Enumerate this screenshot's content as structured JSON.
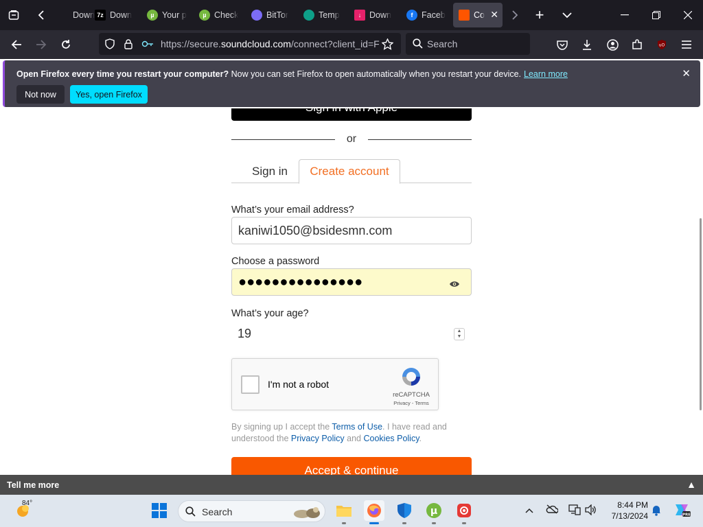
{
  "browser": {
    "tabs": [
      {
        "label": "Down",
        "favicon": "download-icon",
        "color": "#2b2a33"
      },
      {
        "label": "Down",
        "favicon": "7zip-icon",
        "color": "#000000"
      },
      {
        "label": "Your p",
        "favicon": "utorrent-icon",
        "color": "#76b83f"
      },
      {
        "label": "Check",
        "favicon": "utorrent-icon",
        "color": "#76b83f"
      },
      {
        "label": "BitTor",
        "favicon": "gauge-icon",
        "color": "#7b6cf6"
      },
      {
        "label": "Temp",
        "favicon": "temp-mail-icon",
        "color": "#0e9f88"
      },
      {
        "label": "Down",
        "favicon": "download-icon",
        "color": "#e6216a"
      },
      {
        "label": "Faceb",
        "favicon": "facebook-icon",
        "color": "#1877f2"
      },
      {
        "label": "Co",
        "favicon": "soundcloud-icon",
        "color": "#ff5500"
      }
    ],
    "url_prefix": "https://secure.",
    "url_domain": "soundcloud.com",
    "url_rest": "/connect?client_id=F",
    "search_placeholder": "Search"
  },
  "notification": {
    "bold_text": "Open Firefox every time you restart your computer?",
    "text": " Now you can set Firefox to open automatically when you restart your device.",
    "link": "Learn more",
    "not_now": "Not now",
    "yes_open": "Yes, open Firefox"
  },
  "page": {
    "apple_button": "Sign in with Apple",
    "or_text": "or",
    "tab_signin": "Sign in",
    "tab_create": "Create account",
    "email_label": "What’s your email address?",
    "email_value": "kaniwi1050@bsidesmn.com",
    "password_label": "Choose a password",
    "password_dots": "●●●●●●●●●●●●●●●",
    "age_label": "What’s your age?",
    "age_value": "19",
    "captcha_label": "I'm not a robot",
    "captcha_brand": "reCAPTCHA",
    "captcha_links": "Privacy - Terms",
    "terms_1": "By signing up I accept the ",
    "terms_link1": "Terms of Use",
    "terms_2": ". I have read and understood the ",
    "terms_link2": "Privacy Policy",
    "terms_3": " and ",
    "terms_link3": "Cookies Policy",
    "terms_4": ".",
    "accept_button": "Accept & continue",
    "accent_color": "#f95800"
  },
  "banner": {
    "label": "Tell me more"
  },
  "taskbar": {
    "weather_temp": "84°",
    "search_label": "Search",
    "time": "8:44 PM",
    "date": "7/13/2024"
  }
}
